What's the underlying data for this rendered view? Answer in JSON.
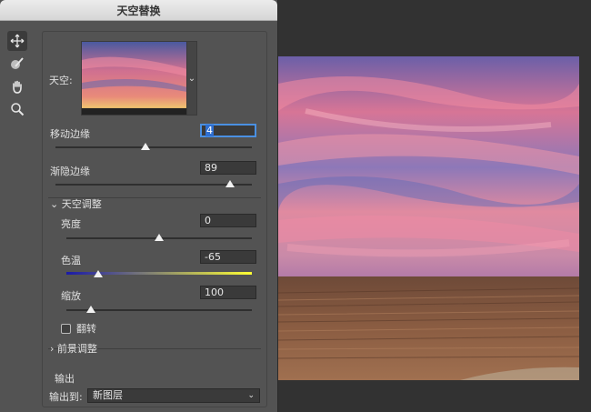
{
  "dialog": {
    "title": "天空替换"
  },
  "tools": [
    {
      "name": "move-tool",
      "icon": "move-icon"
    },
    {
      "name": "sky-brush-tool",
      "icon": "brush-icon"
    },
    {
      "name": "hand-tool",
      "icon": "hand-icon"
    },
    {
      "name": "zoom-tool",
      "icon": "zoom-icon"
    }
  ],
  "sky": {
    "label": "天空:"
  },
  "shift_edge": {
    "label": "移动边缘",
    "value": "4",
    "slider": 0.46
  },
  "fade_edge": {
    "label": "渐隐边缘",
    "value": "89",
    "slider": 0.89
  },
  "sky_adjust": {
    "label": "天空调整"
  },
  "brightness": {
    "label": "亮度",
    "value": "0",
    "slider": 0.5
  },
  "temperature": {
    "label": "色温",
    "value": "-65",
    "slider": 0.17,
    "colors": [
      "#1a1aa8",
      "#ffff33"
    ]
  },
  "scale": {
    "label": "缩放",
    "value": "100",
    "slider": 0.13
  },
  "flip": {
    "label": "翻转",
    "checked": false
  },
  "foreground_adjust": {
    "label": "前景调整"
  },
  "output": {
    "section_label": "输出",
    "label": "输出到:",
    "value": "新图层"
  }
}
